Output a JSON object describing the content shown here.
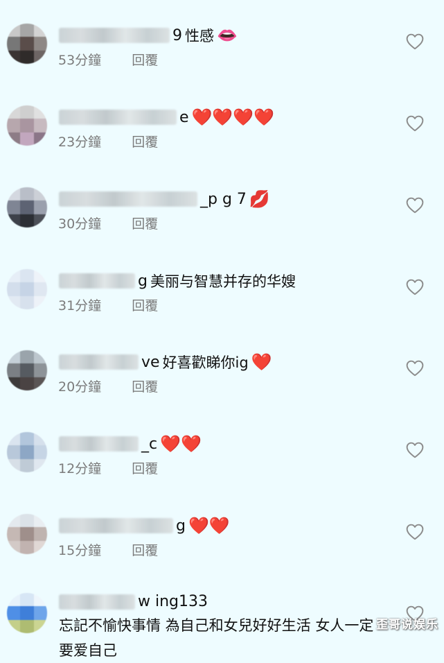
{
  "comments": [
    {
      "username_visible": "9",
      "text": "性感",
      "emoji": "👄",
      "time": "53分鐘",
      "reply": "回覆",
      "avatar_colors": [
        "#c8c8c8",
        "#a6a6a6",
        "#d3d3d3",
        "#777777",
        "#5a4d4a",
        "#8e8885",
        "#3b3433",
        "#2f2b2a",
        "#6d6564"
      ]
    },
    {
      "username_visible": "e",
      "text": "",
      "emoji": "❤️❤️❤️❤️",
      "time": "23分鐘",
      "reply": "回覆",
      "avatar_colors": [
        "#d8d8d8",
        "#cfcfcf",
        "#e0e0e0",
        "#b7a7ad",
        "#a995a0",
        "#c7bac0",
        "#8d7c86",
        "#c2a7be",
        "#8b7688"
      ]
    },
    {
      "username_visible": "_p  g  7",
      "text": "",
      "emoji": "💋",
      "time": "30分鐘",
      "reply": "回覆",
      "avatar_colors": [
        "#d4d8e0",
        "#b9bec8",
        "#ccd0d7",
        "#7f8594",
        "#5d6373",
        "#9aa0ad",
        "#3d414a",
        "#2c2f35",
        "#4c5058"
      ]
    },
    {
      "username_visible": "g",
      "text": "美丽与智慧并存的华嫂",
      "emoji": "",
      "time": "31分鐘",
      "reply": "回覆",
      "avatar_colors": [
        "#e6eef7",
        "#dbe5f1",
        "#eef3f9",
        "#d3deec",
        "#c6d4e6",
        "#dfe7f1",
        "#e2eaf3",
        "#d7e1ed",
        "#edf2f8"
      ]
    },
    {
      "username_visible": "ve",
      "text": "好喜歡睇你ig",
      "emoji": "❤️",
      "time": "20分鐘",
      "reply": "回覆",
      "avatar_colors": [
        "#c5d0d8",
        "#9aa4ab",
        "#bcc6cd",
        "#7b8085",
        "#565b61",
        "#8d9398",
        "#3d3b3b",
        "#4a4343",
        "#5a5555"
      ]
    },
    {
      "username_visible": "_c",
      "text": "",
      "emoji": "❤️❤️",
      "time": "12分鐘",
      "reply": "回覆",
      "avatar_colors": [
        "#dae4ef",
        "#b2c6dc",
        "#d5e0ec",
        "#b8c8da",
        "#8da7c5",
        "#c6d5e5",
        "#d7dfe7",
        "#bfcbd6",
        "#dfe7ef"
      ]
    },
    {
      "username_visible": "g",
      "text": "",
      "emoji": "❤️❤️",
      "time": "15分鐘",
      "reply": "回覆",
      "avatar_colors": [
        "#e4e9ee",
        "#dbe2e8",
        "#e9eef2",
        "#c5b8b4",
        "#9f8f8b",
        "#bfb4b0",
        "#d3cac7",
        "#c1b3b0",
        "#e0d8d5"
      ]
    },
    {
      "username_visible": "w   ing133",
      "text": "忘記不愉快事情  為自己和女兒好好生活 女人一定要爱自己",
      "emoji": "",
      "time": "",
      "reply": "",
      "avatar_colors": [
        "#e7f2fb",
        "#d7e6f5",
        "#eef6fc",
        "#4f8fe6",
        "#3f7fd9",
        "#6ea5ea",
        "#c4cf8a",
        "#aebc72",
        "#cbd592"
      ]
    }
  ],
  "watermark": "歪哥说娱乐",
  "icons": {
    "like": "heart-outline-icon"
  },
  "colors": {
    "background": "#eefcff",
    "meta_text": "#7b7b7b",
    "heart_outline": "#8c8c8c"
  }
}
